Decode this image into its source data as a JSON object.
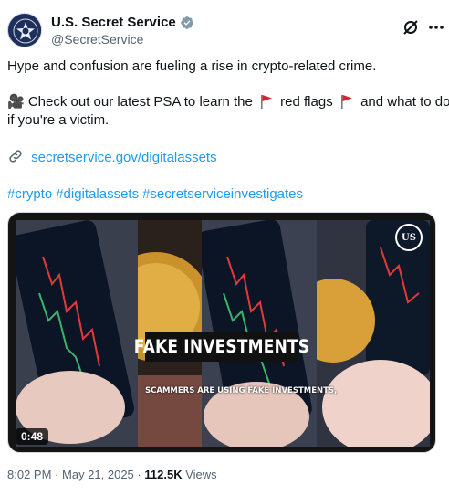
{
  "author": {
    "display_name": "U.S. Secret Service",
    "handle": "@SecretService"
  },
  "tweet": {
    "line1": "Hype and confusion are fueling a rise in crypto-related crime.",
    "line2_part1": "🎥 Check out our latest PSA to learn the",
    "line2_part2": "red flags",
    "line2_part3": "and what to do",
    "line3": "if you're a victim.",
    "link": "secretservice.gov/digitalassets",
    "hashtags": [
      "#crypto",
      "#digitalassets",
      "#secretserviceinvestigates"
    ]
  },
  "media": {
    "overlay_title": "FAKE INVESTMENTS",
    "caption": "SCAMMERS ARE USING FAKE INVESTMENTS,",
    "duration": "0:48",
    "watermark": "US"
  },
  "footer": {
    "time": "8:02 PM",
    "separator": "·",
    "date": "May 21, 2025",
    "views_count": "112.5K",
    "views_label": "Views"
  },
  "colors": {
    "link": "#1d9bf0",
    "text": "#0f1419",
    "muted": "#536471",
    "verified": "#829aab",
    "flag": "#e0202f"
  }
}
